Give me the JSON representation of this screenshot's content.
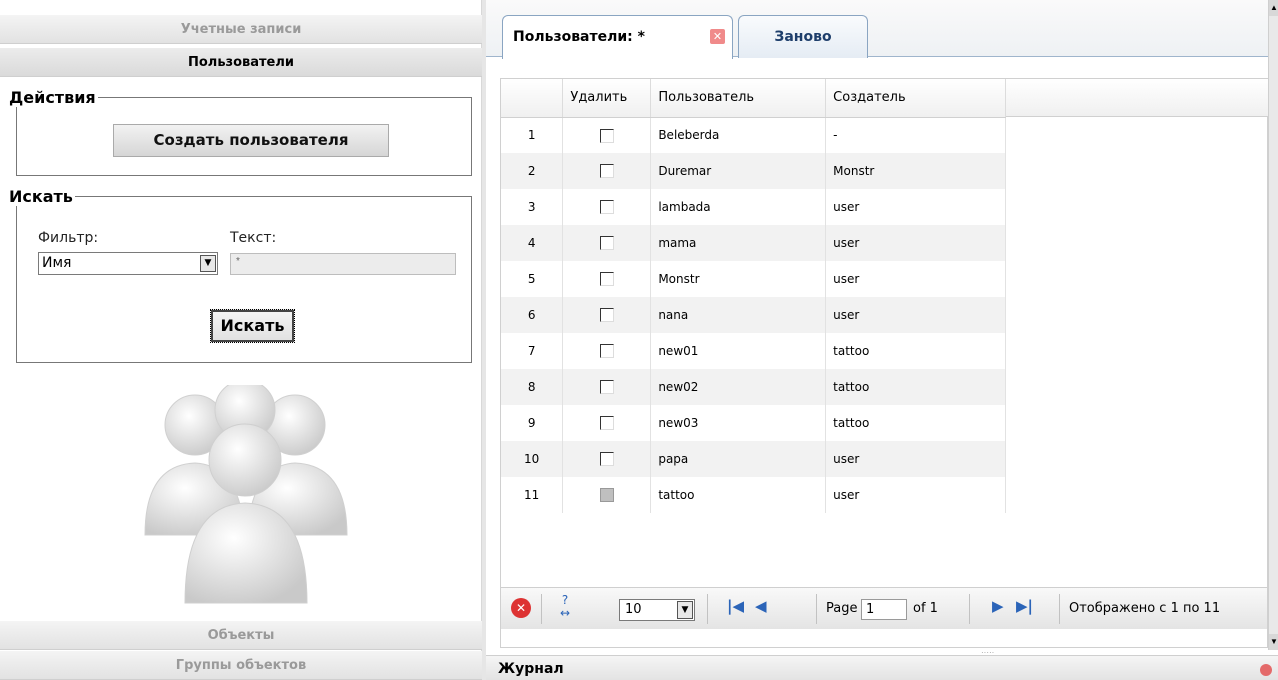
{
  "sidebar": {
    "accounts_header": "Учетные записи",
    "users_header": "Пользователи",
    "actions": {
      "legend": "Действия",
      "create_user_label": "Создать пользователя"
    },
    "search": {
      "legend": "Искать",
      "filter_label": "Фильтр:",
      "filter_value": "Имя",
      "text_label": "Текст:",
      "text_value": "*",
      "search_button_label": "Искать"
    },
    "objects_header": "Объекты",
    "object_groups_header": "Группы объектов"
  },
  "tabs": [
    {
      "label": "Пользователи: *",
      "active": true
    },
    {
      "label": "Заново",
      "active": false
    }
  ],
  "grid": {
    "columns": [
      "",
      "Удалить",
      "Пользователь",
      "Создатель"
    ],
    "rows": [
      {
        "num": "1",
        "user": "Beleberda",
        "creator": "-",
        "checkbox_disabled": false
      },
      {
        "num": "2",
        "user": "Duremar",
        "creator": "Monstr",
        "checkbox_disabled": false
      },
      {
        "num": "3",
        "user": "lambada",
        "creator": "user",
        "checkbox_disabled": false
      },
      {
        "num": "4",
        "user": "mama",
        "creator": "user",
        "checkbox_disabled": false
      },
      {
        "num": "5",
        "user": "Monstr",
        "creator": "user",
        "checkbox_disabled": false
      },
      {
        "num": "6",
        "user": "nana",
        "creator": "user",
        "checkbox_disabled": false
      },
      {
        "num": "7",
        "user": "new01",
        "creator": "tattoo",
        "checkbox_disabled": false
      },
      {
        "num": "8",
        "user": "new02",
        "creator": "tattoo",
        "checkbox_disabled": false
      },
      {
        "num": "9",
        "user": "new03",
        "creator": "tattoo",
        "checkbox_disabled": false
      },
      {
        "num": "10",
        "user": "papa",
        "creator": "user",
        "checkbox_disabled": false
      },
      {
        "num": "11",
        "user": "tattoo",
        "creator": "user",
        "checkbox_disabled": true
      }
    ]
  },
  "pager": {
    "page_size": "10",
    "page_label": "Page",
    "page_value": "1",
    "of_label": "of 1",
    "display_text": "Отображено с 1 по 11"
  },
  "journal": {
    "title": "Журнал"
  },
  "colors": {
    "tab_border": "#8aa5c2",
    "nav_blue": "#2b64b8",
    "cancel_red": "#dd3333"
  }
}
